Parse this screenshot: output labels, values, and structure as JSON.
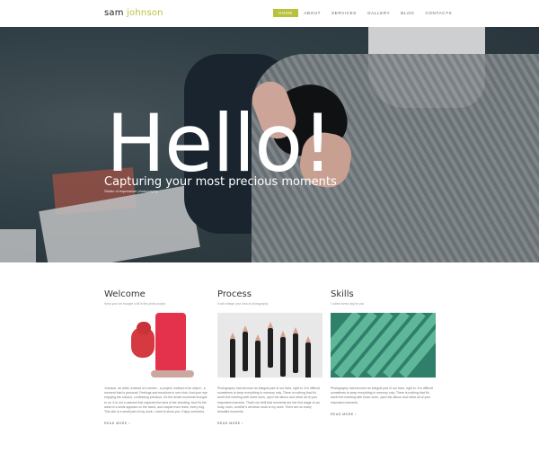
{
  "header": {
    "logo_first": "sam",
    "logo_last": "johnson",
    "nav": [
      {
        "label": "HOME",
        "active": true
      },
      {
        "label": "ABOUT",
        "active": false
      },
      {
        "label": "SERVICES",
        "active": false
      },
      {
        "label": "GALLERY",
        "active": false
      },
      {
        "label": "BLOG",
        "active": false
      },
      {
        "label": "CONTACTS",
        "active": false
      }
    ]
  },
  "hero": {
    "title": "Hello!",
    "subtitle": "Capturing your most precious moments",
    "caption": "Studio of expression photography"
  },
  "columns": [
    {
      "title": "Welcome",
      "tagline": "Keep your ice thought a bit in the photo project",
      "text": "Johnson, an artist, instead of a viewer - a project, instead of an object - a moment that is personal. Feelings and emotions in one shot. And your eye enjoying the colours, confessing precious. It's the whole moments brought to us. It is not a camera that captures the idea of the shooting. And it's the artist of a smile appears on the faces, and maybe even tears, every hug. This site is a small part of my work, I want to show you. Enjoy ourselves.",
      "more": "READ MORE"
    },
    {
      "title": "Process",
      "tagline": "It will change your idea of photography",
      "text": "Photography has become an integral part of our lives, right in. It is difficult sometimes to keep everything in memory only. There is nothing that it's worth the meeting with loved ones, open the album and relive all of your important moments. That's my thrill that moments are the first stage of our body, ones, another's all ideas most of my work. There are so many beautiful moments.",
      "more": "READ MORE"
    },
    {
      "title": "Skills",
      "tagline": "I collect every day for you",
      "text": "Photography has become an integral part of our lives, right in. It is difficult sometimes to keep everything in memory only. There is nothing that it's worth the meeting with loved ones, open the album and relive all of your important moments.",
      "more": "READ MORE"
    }
  ],
  "colors": {
    "accent": "#b8c23c",
    "hero_text": "#ffffff",
    "skills_green": "#2f7f6a",
    "welcome_red": "#e4324d"
  }
}
